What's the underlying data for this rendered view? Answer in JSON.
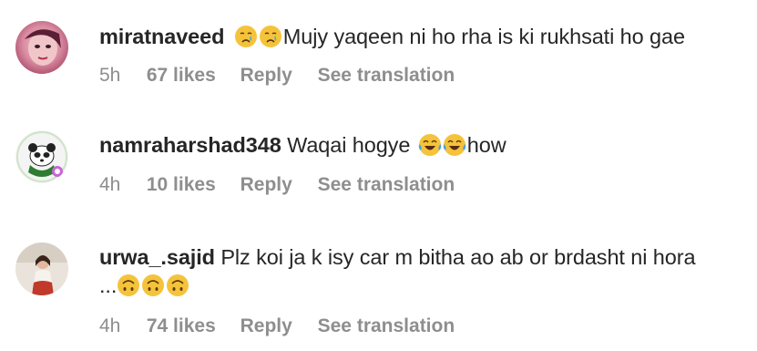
{
  "comments": [
    {
      "username": "miratnaveed",
      "text_after_emoji": "Mujy yaqeen ni ho rha is ki rukhsati ho gae",
      "emojis": [
        "crying-face",
        "crying-face"
      ],
      "time": "5h",
      "likes": "67 likes",
      "reply": "Reply",
      "see_translation": "See translation"
    },
    {
      "username": "namraharshad348",
      "text_before_emoji": "Waqai hogye",
      "text_after_emoji": "how",
      "emojis": [
        "tears-of-joy-face",
        "tears-of-joy-face"
      ],
      "time": "4h",
      "likes": "10 likes",
      "reply": "Reply",
      "see_translation": "See translation"
    },
    {
      "username": "urwa_.sajid",
      "text_line1": "Plz koi ja k isy car m bitha ao ab or brdasht ni hora",
      "text_line2_prefix": "...",
      "emojis": [
        "upside-down-face",
        "upside-down-face",
        "upside-down-face"
      ],
      "time": "4h",
      "likes": "74 likes",
      "reply": "Reply",
      "see_translation": "See translation"
    }
  ],
  "colors": {
    "primary_text": "#262626",
    "secondary_text": "#8e8e8e",
    "background": "#ffffff",
    "emoji_yellow": "#f5c33b",
    "tear_blue": "#4aa3df"
  }
}
